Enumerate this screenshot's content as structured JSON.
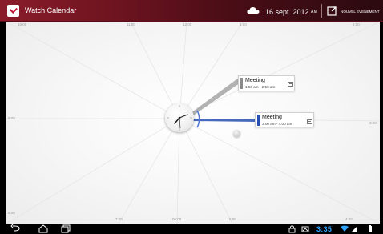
{
  "app": {
    "title": "Watch Calendar"
  },
  "header": {
    "date": "16 sept. 2012",
    "ampm": "AM",
    "new_event": "NOUVEL ÉVÉNEMENT"
  },
  "ticks": {
    "top_left": "10:00",
    "top_1": "11:00",
    "top_2": "12:00",
    "top_3": "1:00",
    "top_right": "2:00",
    "left": "9:00",
    "right": "3:00",
    "bottom_left": "8:00",
    "bottom_1": "7:00",
    "bottom_2": "06:00",
    "bottom_3": "5:00",
    "bottom_right": "4:00"
  },
  "events": [
    {
      "title": "Meeting",
      "time": "1:50 am - 2:50 am",
      "color": "#8a8a8a"
    },
    {
      "title": "Meeting",
      "time": "3:00 am - 4:00 am",
      "color": "#2850b0"
    }
  ],
  "statusbar": {
    "time": "3:35"
  },
  "colors": {
    "accent": "#2ea4ff",
    "event_blue": "#2850b0",
    "brand": "#8a1c2a"
  }
}
